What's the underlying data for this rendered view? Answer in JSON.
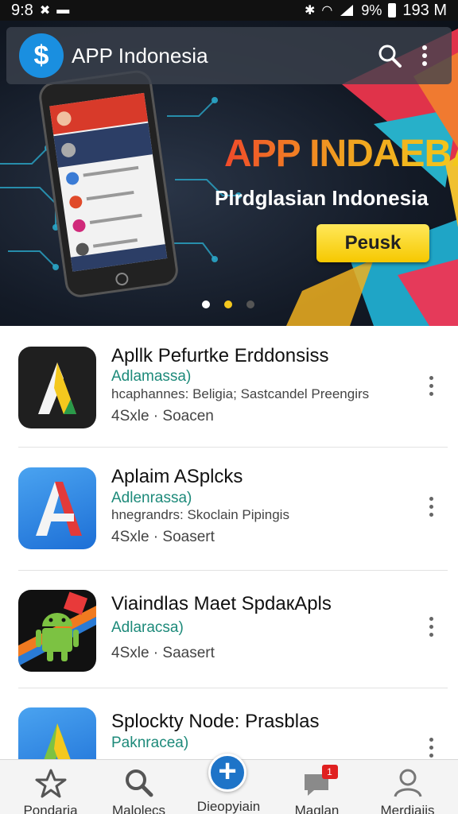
{
  "status_bar": {
    "time": "9:8",
    "battery": "9%",
    "data": "193 M"
  },
  "app_bar": {
    "title": "APP Indonesia",
    "logo_glyph": "$",
    "search_icon": "search-icon",
    "more_icon": "more-vert-icon"
  },
  "hero": {
    "title": "APP INDAEBAI",
    "subtitle": "Plrdglasian Indonesia",
    "cta_label": "Peusk",
    "carousel_active_index": 1,
    "carousel_count": 3
  },
  "apps": [
    {
      "name": "Apllk Pefurtke Erddonsiss",
      "category": "Adlamassa)",
      "description": "hcaphannes: Beligia; Sastcandel Preengirs",
      "meta": "4Sxle · Soacen"
    },
    {
      "name": "Aplaim ASplcks",
      "category": "Adlenrassa)",
      "description": "hnegrandrs: Skoclain Pipingis",
      "meta": "4Sxle · Soasert"
    },
    {
      "name": "Viaindlas Maet SpdaкApls",
      "category": "Adlaracsa)",
      "description": "",
      "meta": "4Sxle · Saasert"
    },
    {
      "name": "Splockty Node: Prasblas",
      "category": "Paknracea)",
      "description": "",
      "meta": ""
    }
  ],
  "bottom_nav": {
    "items": [
      {
        "label": "Pondaria",
        "icon": "star-icon"
      },
      {
        "label": "Malolecs",
        "icon": "search-icon"
      },
      {
        "label": "Dieopyiain",
        "icon": "add-icon"
      },
      {
        "label": "Maglan",
        "icon": "chat-icon",
        "badge": "1"
      },
      {
        "label": "Merdiaiis",
        "icon": "person-icon"
      }
    ]
  },
  "colors": {
    "accent_blue": "#1e74c8",
    "category_teal": "#1d8a7a",
    "cta_yellow": "#f6c800",
    "badge_red": "#e02020"
  }
}
